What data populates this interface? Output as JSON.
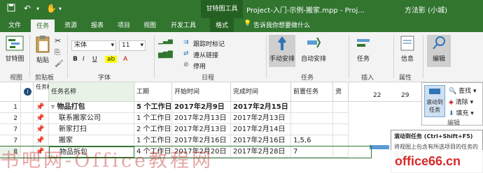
{
  "window": {
    "doc_title": "Project-入门-示例-搬家.mpp - Proj...",
    "context_group": "甘特图工具",
    "user": "方法影 (小城)"
  },
  "tabs": [
    {
      "label": "文件"
    },
    {
      "label": "任务"
    },
    {
      "label": "资源"
    },
    {
      "label": "报表"
    },
    {
      "label": "项目"
    },
    {
      "label": "视图"
    },
    {
      "label": "开发工具"
    },
    {
      "label": "格式"
    }
  ],
  "tell_me": "告诉我你想要做什么",
  "ribbon": {
    "groups": [
      "视图",
      "剪贴板",
      "字体",
      "日程",
      "任务",
      "插入",
      "属性"
    ],
    "gantt_view": "甘特图",
    "paste": "粘贴",
    "font_name": "宋体",
    "font_size": "11",
    "mark_on_track": "跟踪时标记",
    "respect_links": "遵从链接",
    "inactivate": "停用",
    "manual_schedule": "手动安排",
    "auto_schedule": "自动安排",
    "task": "任务",
    "info": "信息",
    "editing": "编辑"
  },
  "popup": {
    "scroll_to_task": "滚动到任务",
    "find": "查找",
    "clear": "清除",
    "fill": "填充",
    "label": "编辑"
  },
  "tooltip": {
    "title": "滚动到任务 (Ctrl+Shift+F5)",
    "body": "将视图上包含有所选项目的任务的区域"
  },
  "columns": [
    "任务模式",
    "任务名称",
    "工期",
    "开始时间",
    "完成时间",
    "前置任务",
    "资"
  ],
  "gantt_days": [
    "22",
    "29"
  ],
  "rows": [
    {
      "id": "1",
      "name": "物品打包",
      "duration": "5 个工作日",
      "start": "2017年2月9日",
      "finish": "2017年2月15日",
      "pred": ""
    },
    {
      "id": "2",
      "name": "联系搬家公司",
      "duration": "1 个工作日",
      "start": "2017年2月13日",
      "finish": "2017年2月13日",
      "pred": ""
    },
    {
      "id": "7",
      "name": "新家打扫",
      "duration": "2 个工作日",
      "start": "2017年2月13日",
      "finish": "2017年2月14日",
      "pred": ""
    },
    {
      "id": "7",
      "name": "搬家",
      "duration": "1 个工作日",
      "start": "2017年2月16日",
      "finish": "2017年2月16日",
      "pred": "1,5,6"
    },
    {
      "id": "8",
      "name": "物品拆包",
      "duration": "4 个工作日",
      "start": "2017年2月20日",
      "finish": "2017年2月28日",
      "pred": "7"
    }
  ],
  "watermark": "书吧网-Office教程网",
  "logo": "office66.cn",
  "colors": {
    "accent": "#31752f",
    "bar": "#5b9bd5",
    "pin": "#2e75b6"
  }
}
